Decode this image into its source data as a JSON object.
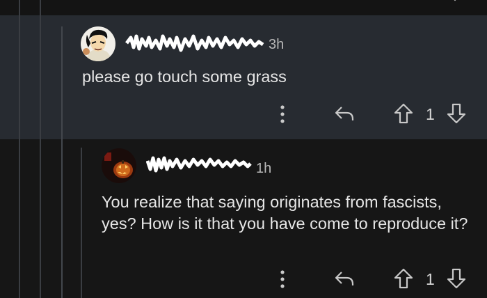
{
  "comments": [
    {
      "username": "████████████",
      "time": "3h",
      "text": "please go touch some grass",
      "vote_count": "1",
      "avatar": "cartoon-portrait-avatar"
    },
    {
      "username": "████████████",
      "time": "1h",
      "text": "You realize that saying originates from fascists, yes?  How is it that you have come to reproduce it?",
      "vote_count": "1",
      "avatar": "dark-pumpkin-avatar"
    }
  ],
  "icons": {
    "more": "more-vertical-icon",
    "reply": "reply-arrow-icon",
    "upvote": "upvote-arrow-icon",
    "downvote": "downvote-arrow-icon"
  },
  "colors": {
    "highlight_bg": "#272b31",
    "page_bg": "#161616",
    "text": "#e6e6e6",
    "meta": "#b8b8b8"
  }
}
